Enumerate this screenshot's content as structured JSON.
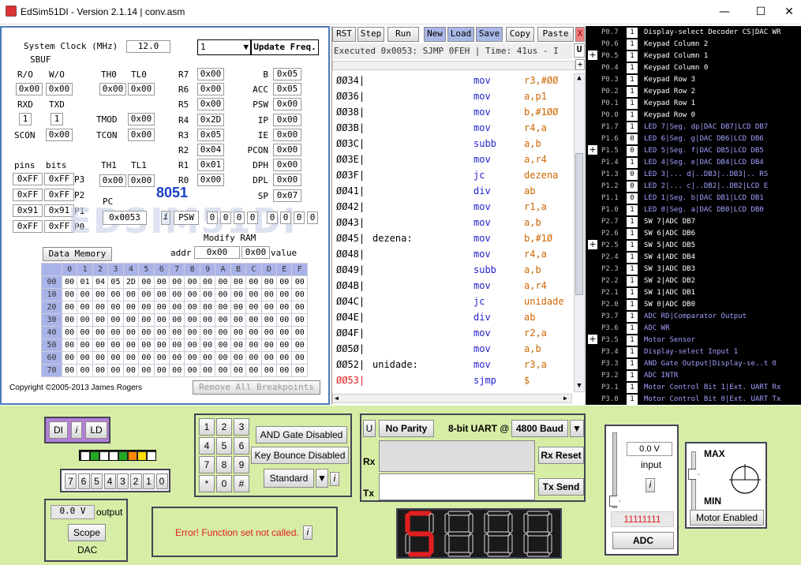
{
  "window": {
    "title": "EdSim51DI - Version 2.1.14 | conv.asm",
    "min": "—",
    "max": "☐",
    "close": "✕"
  },
  "left": {
    "sysclock_label": "System Clock (MHz)",
    "sysclock_value": "12.0",
    "freq_value": "1",
    "update_freq": "Update Freq.",
    "sbuf": "SBUF",
    "rw": "R/O",
    "wo": "W/O",
    "sbuf_r": "0x00",
    "sbuf_w": "0x00",
    "th0_l": "TH0",
    "tl0_l": "TL0",
    "th0": "0x00",
    "tl0": "0x00",
    "rxd_l": "RXD",
    "txd_l": "TXD",
    "rxd": "1",
    "txd": "1",
    "tmod_l": "TMOD",
    "tmod": "0x00",
    "tcon_l": "TCON",
    "tcon": "0x00",
    "scon_l": "SCON",
    "scon": "0x00",
    "regs": [
      {
        "l": "R7",
        "v": "0x00"
      },
      {
        "l": "R6",
        "v": "0x00"
      },
      {
        "l": "R5",
        "v": "0x00"
      },
      {
        "l": "R4",
        "v": "0x2D"
      },
      {
        "l": "R3",
        "v": "0x05"
      },
      {
        "l": "R2",
        "v": "0x04"
      },
      {
        "l": "R1",
        "v": "0x01"
      },
      {
        "l": "R0",
        "v": "0x00"
      }
    ],
    "sfr": [
      {
        "l": "B",
        "v": "0x05"
      },
      {
        "l": "ACC",
        "v": "0x05"
      },
      {
        "l": "PSW",
        "v": "0x00"
      },
      {
        "l": "IP",
        "v": "0x00"
      },
      {
        "l": "IE",
        "v": "0x00"
      },
      {
        "l": "PCON",
        "v": "0x00"
      },
      {
        "l": "DPH",
        "v": "0x00"
      },
      {
        "l": "DPL",
        "v": "0x00"
      },
      {
        "l": "SP",
        "v": "0x07"
      }
    ],
    "pins_l": "pins",
    "bits_l": "bits",
    "th1_l": "TH1",
    "tl1_l": "TL1",
    "th1": "0x00",
    "tl1": "0x00",
    "ports": [
      {
        "pin": "0xFF",
        "bit": "0xFF",
        "l": "P3"
      },
      {
        "pin": "0xFF",
        "bit": "0xFF",
        "l": "P2"
      },
      {
        "pin": "0x91",
        "bit": "0x91",
        "l": "P1"
      },
      {
        "pin": "0xFF",
        "bit": "0xFF",
        "l": "P0"
      }
    ],
    "chip": "8051",
    "pc_l": "PC",
    "pc": "0x0053",
    "psw_l": "PSW",
    "psw_bits": [
      "0",
      "0",
      "0",
      "0",
      "0",
      "0",
      "0",
      "0"
    ],
    "modify_ram": "Modify RAM",
    "addr_l": "addr",
    "addr": "0x00",
    "value": "0x00",
    "value_l": "value",
    "data_memory": "Data Memory",
    "mem_cols": [
      "0",
      "1",
      "2",
      "3",
      "4",
      "5",
      "6",
      "7",
      "8",
      "9",
      "A",
      "B",
      "C",
      "D",
      "E",
      "F"
    ],
    "mem_rows": [
      {
        "a": "00",
        "v": [
          "00",
          "01",
          "04",
          "05",
          "2D",
          "00",
          "00",
          "00",
          "00",
          "00",
          "00",
          "00",
          "00",
          "00",
          "00",
          "00"
        ]
      },
      {
        "a": "10",
        "v": [
          "00",
          "00",
          "00",
          "00",
          "00",
          "00",
          "00",
          "00",
          "00",
          "00",
          "00",
          "00",
          "00",
          "00",
          "00",
          "00"
        ]
      },
      {
        "a": "20",
        "v": [
          "00",
          "00",
          "00",
          "00",
          "00",
          "00",
          "00",
          "00",
          "00",
          "00",
          "00",
          "00",
          "00",
          "00",
          "00",
          "00"
        ]
      },
      {
        "a": "30",
        "v": [
          "00",
          "00",
          "00",
          "00",
          "00",
          "00",
          "00",
          "00",
          "00",
          "00",
          "00",
          "00",
          "00",
          "00",
          "00",
          "00"
        ]
      },
      {
        "a": "40",
        "v": [
          "00",
          "00",
          "00",
          "00",
          "00",
          "00",
          "00",
          "00",
          "00",
          "00",
          "00",
          "00",
          "00",
          "00",
          "00",
          "00"
        ]
      },
      {
        "a": "50",
        "v": [
          "00",
          "00",
          "00",
          "00",
          "00",
          "00",
          "00",
          "00",
          "00",
          "00",
          "00",
          "00",
          "00",
          "00",
          "00",
          "00"
        ]
      },
      {
        "a": "60",
        "v": [
          "00",
          "00",
          "00",
          "00",
          "00",
          "00",
          "00",
          "00",
          "00",
          "00",
          "00",
          "00",
          "00",
          "00",
          "00",
          "00"
        ]
      },
      {
        "a": "70",
        "v": [
          "00",
          "00",
          "00",
          "00",
          "00",
          "00",
          "00",
          "00",
          "00",
          "00",
          "00",
          "00",
          "00",
          "00",
          "00",
          "00"
        ]
      }
    ],
    "copyright": "Copyright ©2005-2013 James Rogers",
    "remove_bp": "Remove All Breakpoints"
  },
  "toolbar": {
    "rst": "RST",
    "step": "Step",
    "run": "Run",
    "new": "New",
    "load": "Load",
    "save": "Save",
    "copy": "Copy",
    "paste": "Paste",
    "x": "X"
  },
  "status": "Executed 0x0053: SJMP 0FEH | Time: 41us - I",
  "code": [
    {
      "a": "ØØ34|",
      "lbl": "",
      "op": "mov",
      "arg": "r3,#ØØ"
    },
    {
      "a": "ØØ36|",
      "lbl": "",
      "op": "mov",
      "arg": "a,p1"
    },
    {
      "a": "ØØ38|",
      "lbl": "",
      "op": "mov",
      "arg": "b,#1ØØ"
    },
    {
      "a": "ØØ3B|",
      "lbl": "",
      "op": "mov",
      "arg": "r4,a"
    },
    {
      "a": "ØØ3C|",
      "lbl": "",
      "op": "subb",
      "arg": "a,b"
    },
    {
      "a": "ØØ3E|",
      "lbl": "",
      "op": "mov",
      "arg": "a,r4"
    },
    {
      "a": "ØØ3F|",
      "lbl": "",
      "op": "jc",
      "arg": "dezena"
    },
    {
      "a": "ØØ41|",
      "lbl": "",
      "op": "div",
      "arg": "ab"
    },
    {
      "a": "ØØ42|",
      "lbl": "",
      "op": "mov",
      "arg": "r1,a"
    },
    {
      "a": "ØØ43|",
      "lbl": "",
      "op": "mov",
      "arg": "a,b"
    },
    {
      "a": "ØØ45|",
      "lbl": "dezena:",
      "op": "mov",
      "arg": "b,#1Ø"
    },
    {
      "a": "ØØ48|",
      "lbl": "",
      "op": "mov",
      "arg": "r4,a"
    },
    {
      "a": "ØØ49|",
      "lbl": "",
      "op": "subb",
      "arg": "a,b"
    },
    {
      "a": "ØØ4B|",
      "lbl": "",
      "op": "mov",
      "arg": "a,r4"
    },
    {
      "a": "ØØ4C|",
      "lbl": "",
      "op": "jc",
      "arg": "unidade"
    },
    {
      "a": "ØØ4E|",
      "lbl": "",
      "op": "div",
      "arg": "ab"
    },
    {
      "a": "ØØ4F|",
      "lbl": "",
      "op": "mov",
      "arg": "r2,a"
    },
    {
      "a": "ØØ5Ø|",
      "lbl": "",
      "op": "mov",
      "arg": "a,b"
    },
    {
      "a": "ØØ52|",
      "lbl": "unidade:",
      "op": "mov",
      "arg": "r3,a"
    },
    {
      "a": "ØØ53|",
      "lbl": "",
      "op": "sjmp",
      "arg": "$"
    }
  ],
  "io": [
    {
      "p": "P0.7",
      "v": "1",
      "d": "Display-select Decoder CS|DAC WR"
    },
    {
      "p": "P0.6",
      "v": "1",
      "d": "Keypad Column 2"
    },
    {
      "p": "P0.5",
      "v": "1",
      "d": "Keypad Column 1"
    },
    {
      "p": "P0.4",
      "v": "1",
      "d": "Keypad Column 0"
    },
    {
      "p": "P0.3",
      "v": "1",
      "d": "Keypad Row 3"
    },
    {
      "p": "P0.2",
      "v": "1",
      "d": "Keypad Row 2"
    },
    {
      "p": "P0.1",
      "v": "1",
      "d": "Keypad Row 1"
    },
    {
      "p": "P0.0",
      "v": "1",
      "d": "Keypad Row 0"
    },
    {
      "p": "P1.7",
      "v": "1",
      "d": "LED 7|Seg. dp|DAC DB7|LCD DB7"
    },
    {
      "p": "P1.6",
      "v": "0",
      "d": "LED 6|Seg. g|DAC DB6|LCD DB6"
    },
    {
      "p": "P1.5",
      "v": "0",
      "d": "LED 5|Seg. f|DAC DB5|LCD DB5"
    },
    {
      "p": "P1.4",
      "v": "1",
      "d": "LED 4|Seg. e|DAC DB4|LCD DB4"
    },
    {
      "p": "P1.3",
      "v": "0",
      "d": "LED 3|... d|..DB3|..DB3|.. RS"
    },
    {
      "p": "P1.2",
      "v": "0",
      "d": "LED 2|... c|..DB2|..DB2|LCD E"
    },
    {
      "p": "P1.1",
      "v": "0",
      "d": "LED 1|Seg. b|DAC DB1|LCD DB1"
    },
    {
      "p": "P1.0",
      "v": "1",
      "d": "LED 0|Seg. a|DAC DB0|LCD DB0"
    },
    {
      "p": "P2.7",
      "v": "1",
      "d": "SW 7|ADC DB7"
    },
    {
      "p": "P2.6",
      "v": "1",
      "d": "SW 6|ADC DB6"
    },
    {
      "p": "P2.5",
      "v": "1",
      "d": "SW 5|ADC DB5"
    },
    {
      "p": "P2.4",
      "v": "1",
      "d": "SW 4|ADC DB4"
    },
    {
      "p": "P2.3",
      "v": "1",
      "d": "SW 3|ADC DB3"
    },
    {
      "p": "P2.2",
      "v": "1",
      "d": "SW 2|ADC DB2"
    },
    {
      "p": "P2.1",
      "v": "1",
      "d": "SW 1|ADC DB1"
    },
    {
      "p": "P2.0",
      "v": "1",
      "d": "SW 0|ADC DB0"
    },
    {
      "p": "P3.7",
      "v": "1",
      "d": "ADC RD|Comparator Output"
    },
    {
      "p": "P3.6",
      "v": "1",
      "d": "ADC WR"
    },
    {
      "p": "P3.5",
      "v": "1",
      "d": "Motor Sensor"
    },
    {
      "p": "P3.4",
      "v": "1",
      "d": "Display-select Input 1"
    },
    {
      "p": "P3.3",
      "v": "1",
      "d": "AND Gate Output|Display-se..t 0"
    },
    {
      "p": "P3.2",
      "v": "1",
      "d": "ADC INTR"
    },
    {
      "p": "P3.1",
      "v": "1",
      "d": "Motor Control Bit 1|Ext. UART Rx"
    },
    {
      "p": "P3.0",
      "v": "1",
      "d": "Motor Control Bit 0|Ext. UART Tx"
    }
  ],
  "peripherals": {
    "di": "DI",
    "i": "i",
    "ld": "LD",
    "led_colors": [
      "#ffffff",
      "#22aa22",
      "#ffffff",
      "#ffffff",
      "#22aa22",
      "#ff8800",
      "#ffdd00",
      "#ffffff"
    ],
    "led_nums": [
      "7",
      "6",
      "5",
      "4",
      "3",
      "2",
      "1",
      "0"
    ],
    "keys": [
      "1",
      "2",
      "3",
      "4",
      "5",
      "6",
      "7",
      "8",
      "9",
      "*",
      "0",
      "#"
    ],
    "and_gate": "AND Gate Disabled",
    "key_bounce": "Key Bounce Disabled",
    "standard": "Standard",
    "u": "U",
    "parity": "No Parity",
    "uart": "8-bit UART @",
    "baud": "4800 Baud",
    "rx": "Rx",
    "tx": "Tx",
    "rx_reset": "Rx Reset",
    "tx_send": "Tx Send",
    "dac_v": "0.0 V",
    "output": "output",
    "scope": "Scope",
    "dac": "DAC",
    "lcd_msg": "Error! Function set not called.",
    "adc_v": "0.0 V",
    "input": "input",
    "adc_bits": "11111111",
    "adc": "ADC",
    "max": "MAX",
    "min": "MIN",
    "motor": "Motor Enabled"
  },
  "colors": {
    "accent": "#4a7ab8",
    "chip": "#1a3fc8",
    "op": "#2222cc",
    "arg": "#cc6600",
    "breakpoint": "#e02020"
  }
}
